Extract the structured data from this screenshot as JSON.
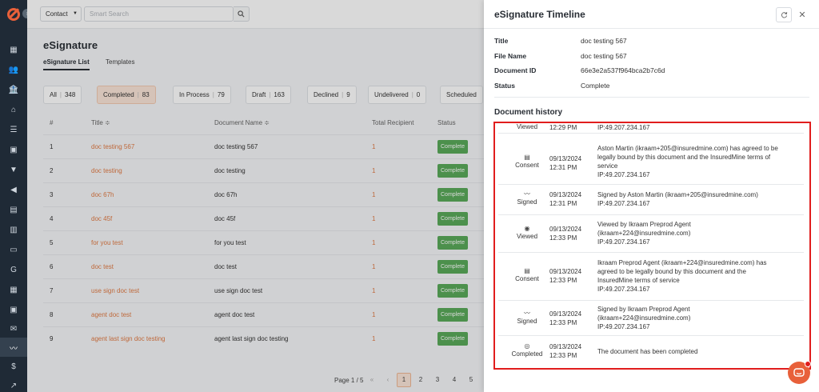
{
  "app": {
    "sidebar_icons": [
      "dashboard-icon",
      "contacts-icon",
      "building-icon",
      "list-icon",
      "contact-card-icon",
      "filter-icon",
      "megaphone-icon",
      "document-icon",
      "chart-icon",
      "folder-icon",
      "g-icon",
      "spreadsheet-icon",
      "calendar-icon",
      "mail-icon",
      "signature-icon",
      "dollar-icon",
      "analytics-icon"
    ],
    "accent": "#e8603a"
  },
  "topbar": {
    "contact_select": "Contact",
    "search_placeholder": "Smart Search"
  },
  "page": {
    "title": "eSignature",
    "tabs": [
      {
        "label": "eSignature List",
        "active": true
      },
      {
        "label": "Templates",
        "active": false
      }
    ],
    "filters": [
      {
        "label": "All",
        "count": "348"
      },
      {
        "label": "Completed",
        "count": "83",
        "active": true
      },
      {
        "label": "In Process",
        "count": "79"
      },
      {
        "label": "Draft",
        "count": "163"
      },
      {
        "label": "Declined",
        "count": "9"
      },
      {
        "label": "Undelivered",
        "count": "0"
      },
      {
        "label": "Scheduled",
        "count": ""
      }
    ],
    "table": {
      "headers": [
        "#",
        "Title ≑",
        "Document Name ≑",
        "Total Recipient",
        "Status"
      ],
      "rows": [
        {
          "num": "1",
          "title": "doc testing 567",
          "doc": "doc testing 567",
          "recipients": "1",
          "status": "Complete"
        },
        {
          "num": "2",
          "title": "doc testing",
          "doc": "doc testing",
          "recipients": "1",
          "status": "Complete"
        },
        {
          "num": "3",
          "title": "doc 67h",
          "doc": "doc 67h",
          "recipients": "1",
          "status": "Complete"
        },
        {
          "num": "4",
          "title": "doc 45f",
          "doc": "doc 45f",
          "recipients": "1",
          "status": "Complete"
        },
        {
          "num": "5",
          "title": "for you test",
          "doc": "for you test",
          "recipients": "1",
          "status": "Complete"
        },
        {
          "num": "6",
          "title": "doc test",
          "doc": "doc test",
          "recipients": "1",
          "status": "Complete"
        },
        {
          "num": "7",
          "title": "use sign doc test",
          "doc": "use sign doc test",
          "recipients": "1",
          "status": "Complete"
        },
        {
          "num": "8",
          "title": "agent doc test",
          "doc": "agent doc test",
          "recipients": "1",
          "status": "Complete"
        },
        {
          "num": "9",
          "title": "agent last sign doc testing",
          "doc": "agent last sign doc testing",
          "recipients": "1",
          "status": "Complete"
        }
      ]
    },
    "pagination": {
      "label": "Page 1 / 5",
      "first": "«",
      "prev": "‹",
      "pages": [
        "1",
        "2",
        "3",
        "4",
        "5"
      ],
      "current": "1"
    }
  },
  "drawer": {
    "title": "eSignature Timeline",
    "meta": [
      {
        "label": "Title",
        "value": "doc testing 567"
      },
      {
        "label": "File Name",
        "value": "doc testing 567"
      },
      {
        "label": "Document ID",
        "value": "66e3e2a537f964bca2b7c6d"
      },
      {
        "label": "Status",
        "value": "Complete"
      }
    ],
    "history_title": "Document history",
    "history": [
      {
        "event": "Viewed",
        "icon": "eye-icon",
        "date": "",
        "time": "12:29 PM",
        "lines": [
          "IP:49.207.234.167"
        ]
      },
      {
        "event": "Consent",
        "icon": "consent-icon",
        "date": "09/13/2024",
        "time": "12:31 PM",
        "lines": [
          "Aston Martin (ikraam+205@insuredmine.com) has agreed to be legally bound by this document and the InsuredMine terms of service",
          "IP:49.207.234.167"
        ]
      },
      {
        "event": "Signed",
        "icon": "signature-icon",
        "date": "09/13/2024",
        "time": "12:31 PM",
        "lines": [
          "Signed by Aston Martin (ikraam+205@insuredmine.com)",
          "IP:49.207.234.167"
        ]
      },
      {
        "event": "Viewed",
        "icon": "eye-icon",
        "date": "09/13/2024",
        "time": "12:33 PM",
        "lines": [
          "Viewed by Ikraam Preprod Agent (ikraam+224@insuredmine.com)",
          "IP:49.207.234.167"
        ]
      },
      {
        "event": "Consent",
        "icon": "consent-icon",
        "date": "09/13/2024",
        "time": "12:33 PM",
        "lines": [
          "Ikraam Preprod Agent (ikraam+224@insuredmine.com) has agreed to be legally bound by this document and the InsuredMine terms of service",
          "IP:49.207.234.167"
        ]
      },
      {
        "event": "Signed",
        "icon": "signature-icon",
        "date": "09/13/2024",
        "time": "12:33 PM",
        "lines": [
          "Signed by Ikraam Preprod Agent (ikraam+224@insuredmine.com)",
          "IP:49.207.234.167"
        ]
      },
      {
        "event": "Completed",
        "icon": "check-circle-icon",
        "date": "09/13/2024",
        "time": "12:33 PM",
        "lines": [
          "The document has been completed"
        ]
      }
    ]
  }
}
